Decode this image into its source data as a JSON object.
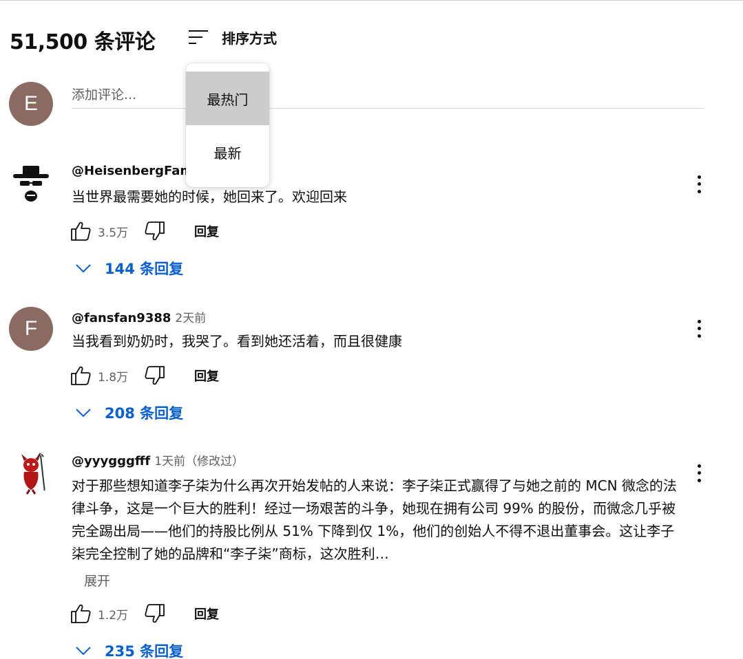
{
  "header": {
    "comments_count": "51,500 条评论",
    "sort_label": "排序方式"
  },
  "add_comment": {
    "avatar_letter": "E",
    "placeholder": "添加评论..."
  },
  "sort_menu": {
    "options": [
      "最热门",
      "最新"
    ],
    "highlighted": "最热门"
  },
  "comments": [
    {
      "author": "@HeisenbergFam",
      "timestamp": "",
      "text": "当世界最需要她的时候，她回来了。欢迎回来",
      "likes": "3.5万",
      "reply_label": "回复",
      "replies_label": "144 条回复",
      "avatar": "heisenberg-avatar"
    },
    {
      "author": "@fansfan9388",
      "timestamp": "2天前",
      "text": "当我看到奶奶时，我哭了。看到她还活着，而且很健康",
      "likes": "1.8万",
      "reply_label": "回复",
      "replies_label": "208 条回复",
      "avatar_letter": "F"
    },
    {
      "author": "@yyygggfff",
      "timestamp": "1天前（修改过）",
      "text": "对于那些想知道李子柒为什么再次开始发帖的人来说：李子柒正式赢得了与她之前的 MCN 微念的法律斗争，这是一个巨大的胜利！经过一场艰苦的斗争，她现在拥有公司 99% 的股份，而微念几乎被完全踢出局——他们的持股比例从 51% 下降到仅 1%，他们的创始人不得不退出董事会。这让李子柒完全控制了她的品牌和“李子柒”商标，这次胜利…",
      "expand_label": "展开",
      "likes": "1.2万",
      "reply_label": "回复",
      "replies_label": "235 条回复",
      "avatar": "devil-avatar"
    }
  ],
  "colors": {
    "link_blue": "#065fd4",
    "secondary_text": "#606060",
    "avatar_e": "#8b6b61",
    "avatar_f": "#8b6b61",
    "menu_highlight": "#cccccc"
  }
}
